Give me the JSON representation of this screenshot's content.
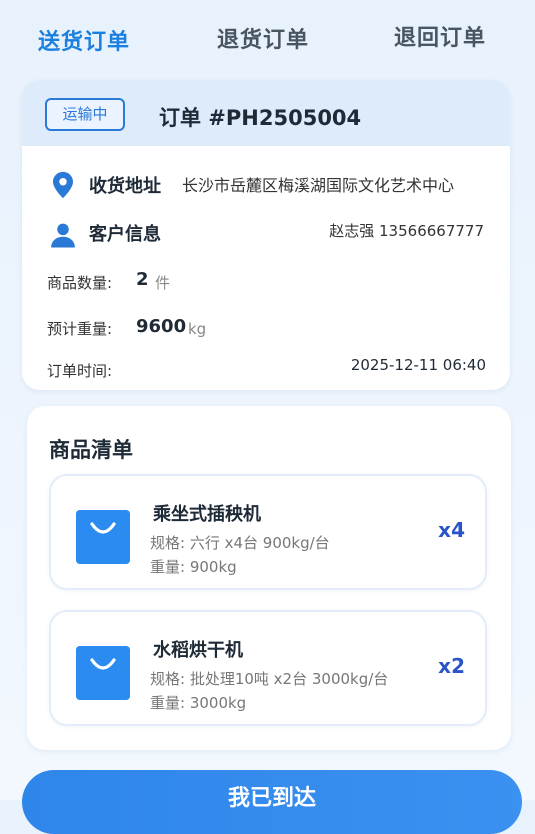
{
  "tabs": [
    {
      "label": "送货订单",
      "active": true
    },
    {
      "label": "退货订单",
      "active": false
    },
    {
      "label": "退回订单",
      "active": false
    }
  ],
  "order": {
    "status": "运输中",
    "title": "订单 #PH2505004",
    "address_label": "收货地址",
    "address_value": "长沙市岳麓区梅溪湖国际文化艺术中心",
    "customer_label": "客户信息",
    "customer_value": "赵志强  13566667777",
    "qty_label": "商品数量:",
    "qty_value": "2",
    "qty_unit": "件",
    "weight_label": "预计重量:",
    "weight_value": "9600",
    "weight_unit": "kg",
    "time_label": "订单时间:",
    "time_value": "2025-12-11  06:40"
  },
  "goods": {
    "title": "商品清单",
    "items": [
      {
        "name": "乘坐式插秧机",
        "spec": "规格: 六行 x4台 900kg/台",
        "weight": "重量: 900kg",
        "qty": "x4"
      },
      {
        "name": "水稻烘干机",
        "spec": "规格: 批处理10吨 x2台 3000kg/台",
        "weight": "重量: 3000kg",
        "qty": "x2"
      }
    ]
  },
  "confirm_button": "我已到达",
  "icons": {
    "address": "location-pin-icon",
    "customer": "person-icon",
    "goods": "shopping-bag-icon"
  },
  "colors": {
    "accent": "#1b7fe0",
    "status": "#2a79d6",
    "bag": "#2a8bf0",
    "qty": "#2a55c8"
  }
}
